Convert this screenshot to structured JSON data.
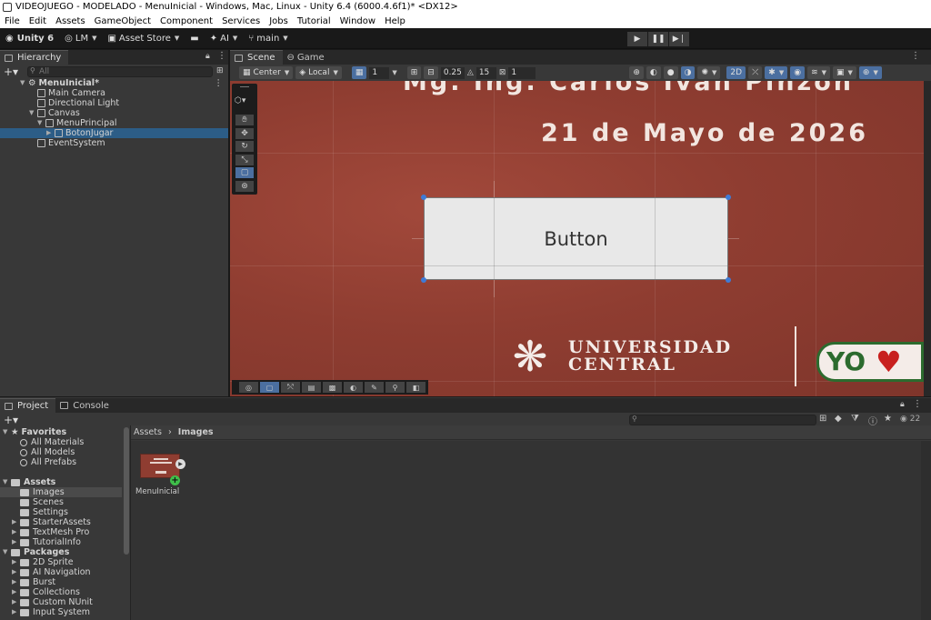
{
  "window": {
    "title": "VIDEOJUEGO - MODELADO - MenuInicial - Windows, Mac, Linux - Unity 6.4 (6000.4.6f1)* <DX12>"
  },
  "menu": [
    "File",
    "Edit",
    "Assets",
    "GameObject",
    "Component",
    "Services",
    "Jobs",
    "Tutorial",
    "Window",
    "Help"
  ],
  "toolbar": {
    "unity": "Unity 6",
    "account": "LM",
    "asset_store": "Asset Store",
    "ai": "AI",
    "branch": "main"
  },
  "hierarchy": {
    "tab": "Hierarchy",
    "search_placeholder": "All",
    "items": [
      {
        "label": "MenuInicial*"
      },
      {
        "label": "Main Camera"
      },
      {
        "label": "Directional Light"
      },
      {
        "label": "Canvas"
      },
      {
        "label": "MenuPrincipal"
      },
      {
        "label": "BotonJugar"
      },
      {
        "label": "EventSystem"
      }
    ]
  },
  "scene": {
    "tabs": [
      "Scene",
      "Game"
    ],
    "pivot": "Center",
    "space": "Local",
    "grid_value": "1",
    "snap_value": "0.25",
    "rotate_snap": "15",
    "scale_snap": "1",
    "mode_2d": "2D",
    "text_top": "Mg. Ing. Carlos Ivan Pinzon",
    "text_date": "21 de Mayo de 2026",
    "button_label": "Button",
    "logo_line1": "UNIVERSIDAD",
    "logo_line2": "CENTRAL",
    "partner_logo": "YO"
  },
  "project": {
    "tabs": [
      "Project",
      "Console"
    ],
    "favorites_header": "Favorites",
    "favorites": [
      "All Materials",
      "All Models",
      "All Prefabs"
    ],
    "assets_header": "Assets",
    "assets": [
      "Images",
      "Scenes",
      "Settings",
      "StarterAssets",
      "TextMesh Pro",
      "TutorialInfo"
    ],
    "packages_header": "Packages",
    "packages": [
      "2D Sprite",
      "AI Navigation",
      "Burst",
      "Collections",
      "Custom NUnit",
      "Input System"
    ],
    "breadcrumb_root": "Assets",
    "breadcrumb_current": "Images",
    "asset_item": "MenuInicial",
    "visible_count": "22"
  },
  "colors": {
    "accent": "#2c5d87",
    "scene_bg": "#8f3d31",
    "handle": "#3f7bd6"
  }
}
